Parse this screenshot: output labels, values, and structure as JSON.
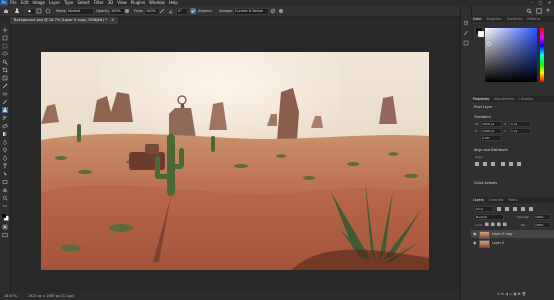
{
  "app": {
    "logo": "Ps"
  },
  "menu": [
    "File",
    "Edit",
    "Image",
    "Layer",
    "Type",
    "Select",
    "Filter",
    "3D",
    "View",
    "Plugins",
    "Window",
    "Help"
  ],
  "window_controls": [
    "–",
    "▢",
    "✕"
  ],
  "options": {
    "mode_label": "Mode:",
    "mode_value": "Normal",
    "opacity_label": "Opacity:",
    "opacity_value": "100%",
    "flow_label": "Flow:",
    "flow_value": "100%",
    "size_value": "0°",
    "align_label": "Aligned",
    "sample_label": "Sample:",
    "sample_value": "Current & Below"
  },
  "document_tab": "Background.psd @ 16.7% (Layer 0 copy, RGB/8#) *",
  "status": {
    "zoom": "16.67%",
    "doc_size": "1920 px x 1080 px (72 ppi)"
  },
  "color_panel": {
    "tabs": [
      "Color",
      "Swatches",
      "Gradients",
      "Patterns"
    ]
  },
  "properties_panel": {
    "tabs": [
      "Properties",
      "Adjustments",
      "Libraries"
    ],
    "pixel_layer": "Pixel Layer",
    "transform_title": "Transform",
    "w": "1920 px",
    "h": "1080 px",
    "x": "0 px",
    "y": "0 px",
    "angle": "0.00°",
    "align_title": "Align and Distribute",
    "align_label": "Align:",
    "quick_actions": "Quick Actions"
  },
  "layers_panel": {
    "tabs": [
      "Layers",
      "Channels",
      "Paths"
    ],
    "kind_label": "Kind",
    "blend": "Normal",
    "opacity_label": "Opacity:",
    "opacity_value": "100%",
    "lock_label": "Lock:",
    "fill_label": "Fill:",
    "fill_value": "100%",
    "layers": [
      {
        "name": "Layer 0 copy",
        "selected": true
      },
      {
        "name": "Layer 0",
        "selected": false
      }
    ],
    "footer_icons": "⊖  fx  ◑  ▭  ▣  ✚  🗑"
  },
  "colors": {
    "accent": "#3f6f9f",
    "canvas_bg": "#282828",
    "sky": "#e8dccb",
    "sand": "#b5694a"
  }
}
